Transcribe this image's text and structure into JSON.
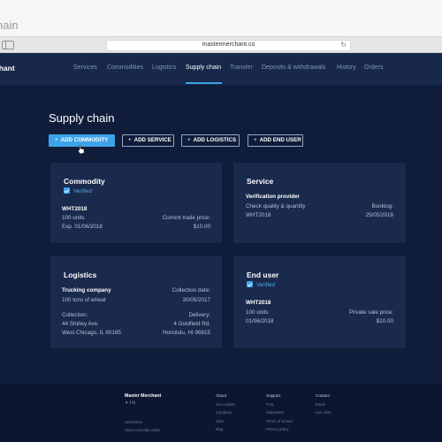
{
  "window": {
    "title": "hain"
  },
  "browser": {
    "url": "mastermerchant.co",
    "reload_icon": "reload-icon"
  },
  "app": {
    "brand": "chant",
    "nav": [
      "Services",
      "Commodities",
      "Logistics",
      "Supply chain",
      "Transfer",
      "Deposits & withdrawals",
      "History",
      "Orders"
    ],
    "active_nav": "Supply chain"
  },
  "page": {
    "title": "Supply chain",
    "buttons": [
      "ADD COMMODITY",
      "ADD SERVICE",
      "ADD LOGISTICS",
      "ADD END USER"
    ]
  },
  "cards": {
    "commodity": {
      "title": "Commodity",
      "verified": "Verified",
      "code": "WHT2018",
      "units": "100 units",
      "expiry": "Exp. 01/06/2018",
      "price_label": "Current trade price:",
      "price": "$10.00"
    },
    "service": {
      "title": "Service",
      "provider": "Verification provider",
      "desc": "Check quality & quantity",
      "code": "WHT2018",
      "booking_label": "Booking:",
      "booking_date": "25/05/2018"
    },
    "logistics": {
      "title": "Logistics",
      "company": "Trucking company",
      "cargo": "100 tons of wheat",
      "collection_date_label": "Collection date:",
      "collection_date": "30/05/2017",
      "collection_label": "Collection:",
      "collection_addr1": "44 Shirley Ave.",
      "collection_addr2": "West Chicago, IL 60185",
      "delivery_label": "Delivery:",
      "delivery_addr1": "4 Goldfield Rd.",
      "delivery_addr2": "Honolulu, HI 96815"
    },
    "enduser": {
      "title": "End user",
      "verified": "Verified",
      "code": "WHT2018",
      "units": "100 units",
      "date": "01/06/2018",
      "price_label": "Private sale price:",
      "price": "$10.00"
    }
  },
  "footer": {
    "brand": "Master Merchant",
    "social": "twitter facebook linkedin",
    "social_glyphs": "✦  f  in",
    "servertime": "Servertime",
    "users_online": "Users currently online",
    "about": {
      "heading": "About",
      "links": [
        "Our mission",
        "Company",
        "Jobs",
        "Blog"
      ]
    },
    "support": {
      "heading": "Support",
      "links": [
        "FAQ",
        "Helpcenter",
        "Terms of service",
        "Privacy policy"
      ]
    },
    "contact": {
      "heading": "Contact",
      "links": [
        "Email",
        "Live chat"
      ]
    }
  }
}
